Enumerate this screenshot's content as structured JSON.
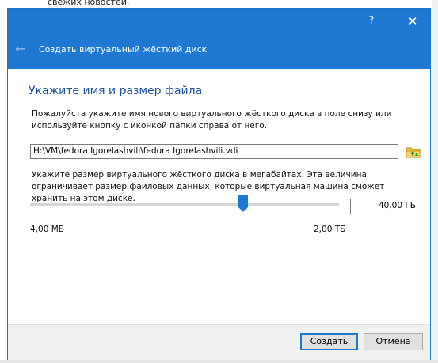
{
  "background": {
    "partial_text": "свежих новостей."
  },
  "dialog": {
    "title": "Создать виртуальный жёсткий диск",
    "help_symbol": "?",
    "close_symbol": "✕",
    "back_symbol": "←"
  },
  "page": {
    "heading": "Укажите имя и размер файла",
    "location_desc": "Пожалуйста укажите имя нового виртуального жёсткого диска в поле снизу или используйте кнопку с иконкой папки справа от него.",
    "file_path": "H:\\VM\\fedora Igorelashvili\\fedora Igorelashvili.vdi",
    "size_desc": "Укажите размер виртуального жёсткого диска в мегабайтах. Эта величина ограничивает размер файловых данных, которые виртуальная машина сможет хранить на этом диске.",
    "size_value": "40,00 ГБ",
    "slider_min": "4,00 МБ",
    "slider_max": "2,00 ТБ",
    "slider_fraction": 0.69
  },
  "buttons": {
    "create": "Создать",
    "cancel": "Отмена"
  },
  "colors": {
    "accent": "#1f78d1",
    "heading": "#1b4fa0"
  }
}
